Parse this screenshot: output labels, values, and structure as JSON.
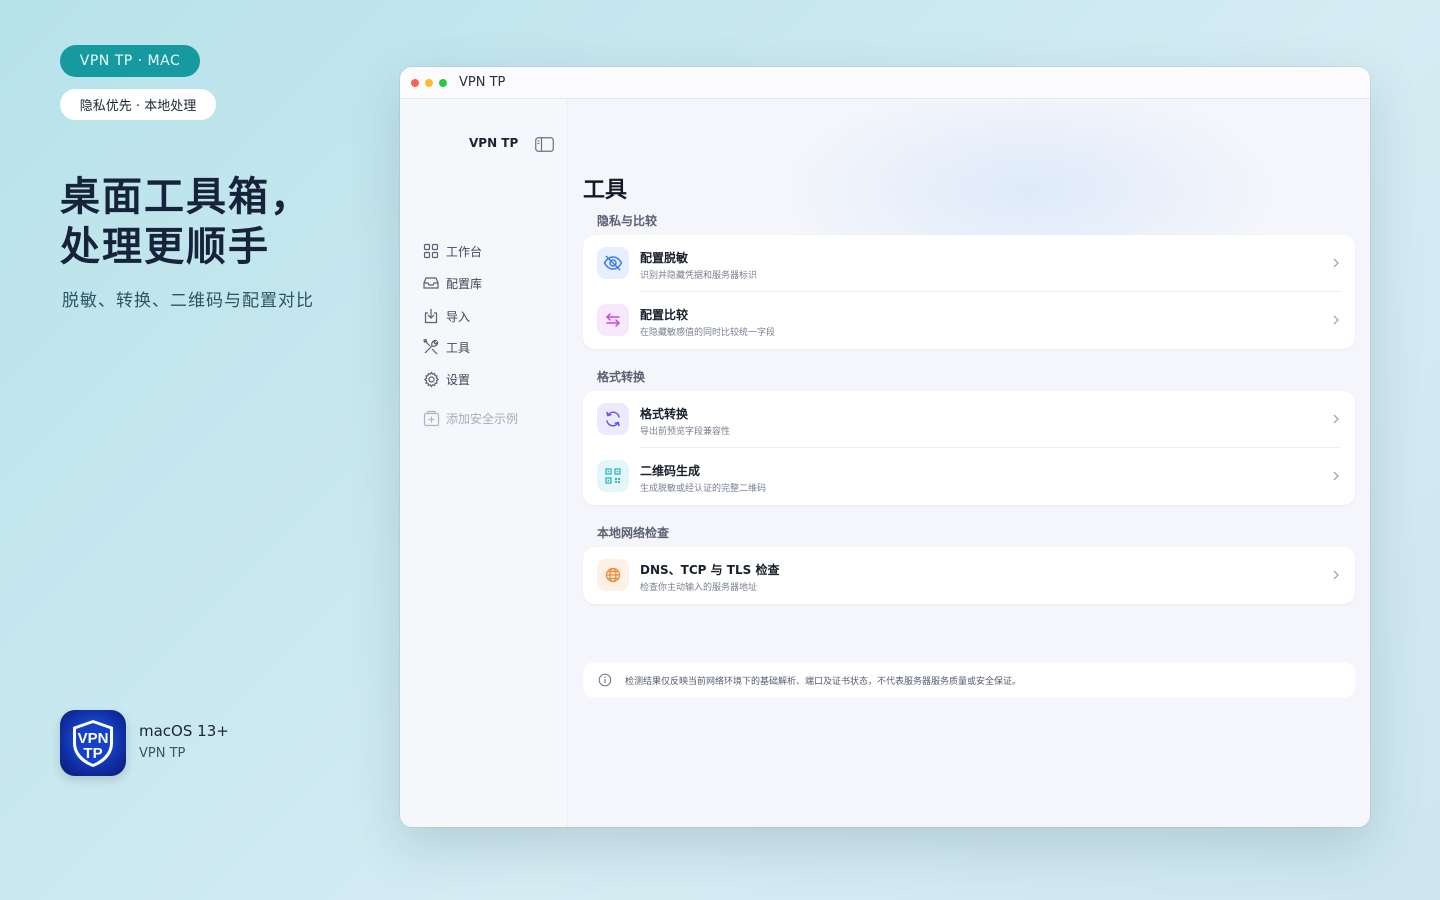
{
  "promo": {
    "pill": "VPN TP · MAC",
    "chip": "隐私优先 · 本地处理",
    "headline_line1": "桌面工具箱，",
    "headline_line2": "处理更顺手",
    "subtitle": "脱敏、转换、二维码与配置对比",
    "app_icon_text_top": "VPN",
    "app_icon_text_bottom": "TP",
    "os_requirement": "macOS 13+",
    "app_name": "VPN TP"
  },
  "window": {
    "title": "VPN TP"
  },
  "sidebar": {
    "title": "VPN TP",
    "items": [
      {
        "label": "工作台",
        "icon": "grid-icon"
      },
      {
        "label": "配置库",
        "icon": "tray-icon"
      },
      {
        "label": "导入",
        "icon": "import-icon"
      },
      {
        "label": "工具",
        "icon": "tools-icon"
      },
      {
        "label": "设置",
        "icon": "gear-icon"
      }
    ],
    "disabled_item": {
      "label": "添加安全示例",
      "icon": "add-box-icon"
    }
  },
  "main": {
    "title": "工具",
    "sections": [
      {
        "label": "隐私与比较",
        "rows": [
          {
            "title": "配置脱敏",
            "desc": "识别并隐藏凭据和服务器标识",
            "icon": "eye-slash-icon",
            "color": "#3a7cf2",
            "bg": "#e6efff"
          },
          {
            "title": "配置比较",
            "desc": "在隐藏敏感值的同时比较统一字段",
            "icon": "swap-icon",
            "color": "#c24ad6",
            "bg": "#f7e8fb"
          }
        ]
      },
      {
        "label": "格式转换",
        "rows": [
          {
            "title": "格式转换",
            "desc": "导出前预览字段兼容性",
            "icon": "refresh-icon",
            "color": "#6a55e0",
            "bg": "#ecebfd"
          },
          {
            "title": "二维码生成",
            "desc": "生成脱敏或经认证的完整二维码",
            "icon": "qr-icon",
            "color": "#33b6c4",
            "bg": "#e5f6f8"
          }
        ]
      },
      {
        "label": "本地网络检查",
        "rows": [
          {
            "title": "DNS、TCP 与 TLS 检查",
            "desc": "检查你主动输入的服务器地址",
            "icon": "globe-icon",
            "color": "#f08a3a",
            "bg": "#fdf0e5"
          }
        ]
      }
    ],
    "notice": "检测结果仅反映当前网络环境下的基础解析、端口及证书状态，不代表服务器服务质量或安全保证。"
  }
}
